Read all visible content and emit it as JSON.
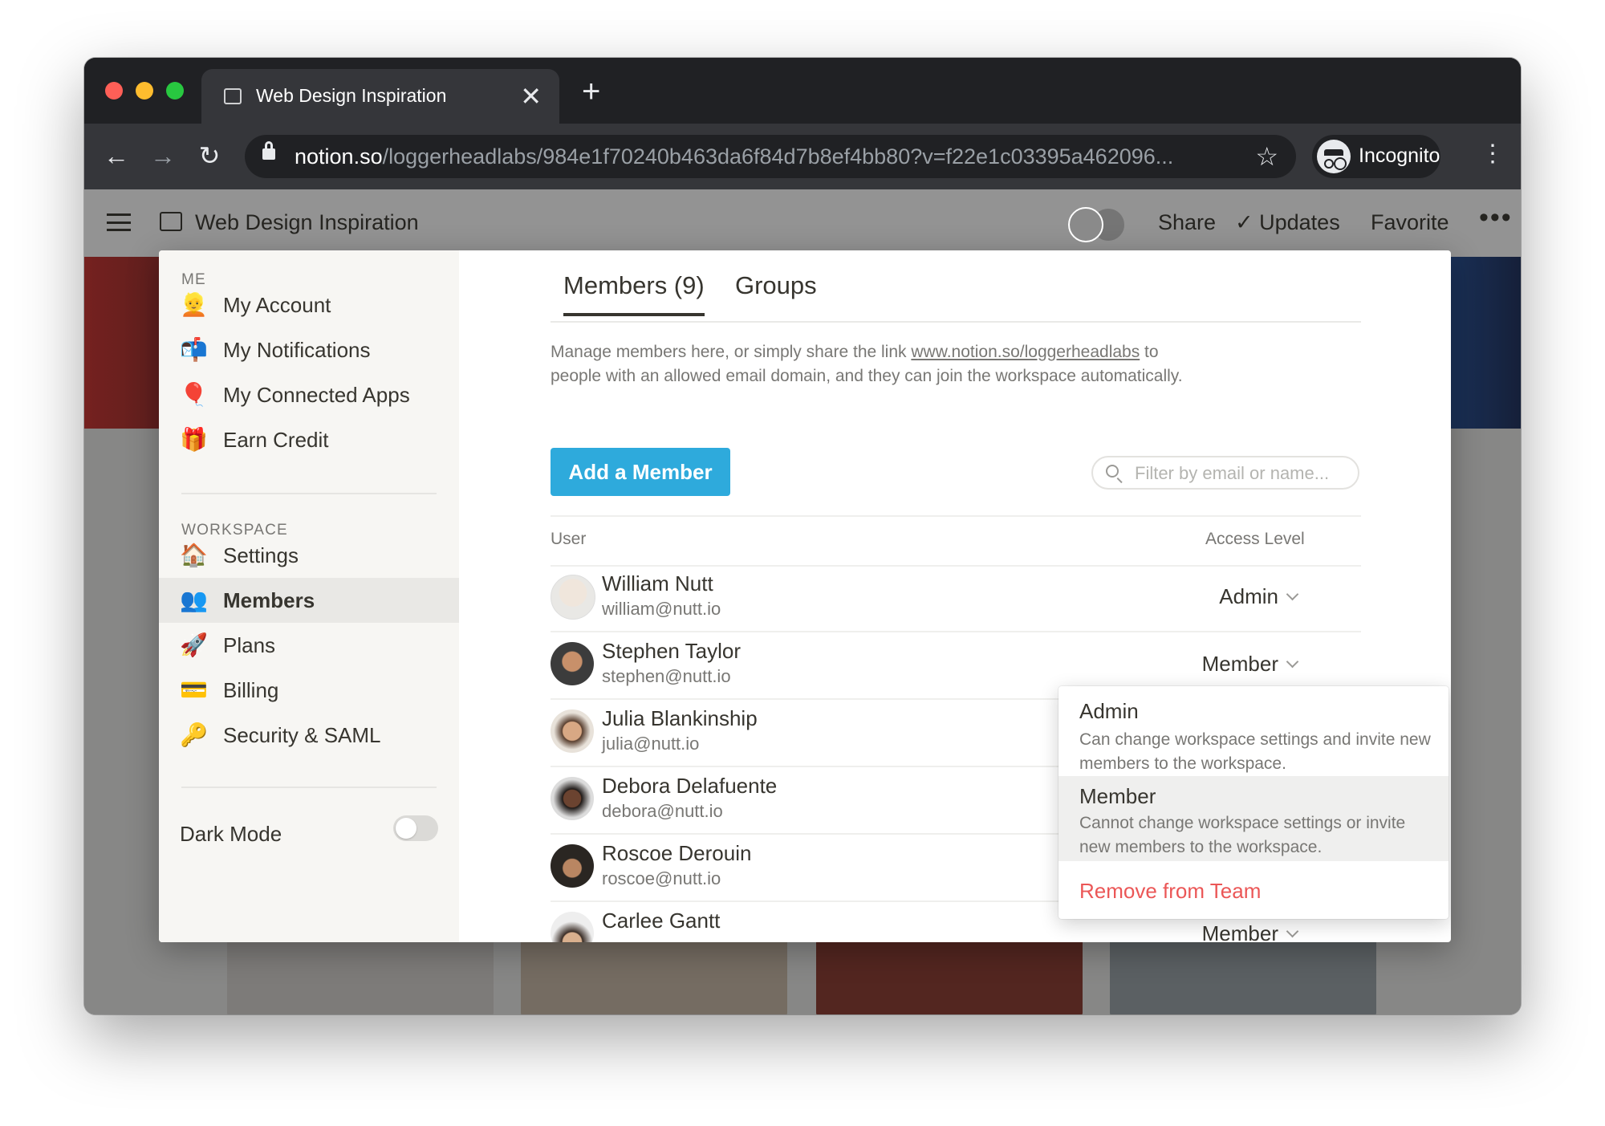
{
  "browser": {
    "tab_title": "Web Design Inspiration",
    "tab_close": "✕",
    "new_tab": "+",
    "url_host": "notion.so",
    "url_path": "/loggerheadlabs/984e1f70240b463da6f84d7b8ef4bb80?v=f22e1c03395a462096...",
    "incognito_label": "Incognito",
    "colors": {
      "chrome_dark": "#202124",
      "chrome_tab": "#35363a",
      "close": "#ff5f57",
      "minimize": "#febc2e",
      "zoom": "#28c840"
    }
  },
  "topbar": {
    "page_title": "Web Design Inspiration",
    "share": "Share",
    "updates": "Updates",
    "favorite": "Favorite",
    "more": "•••"
  },
  "sidebar": {
    "me_heading": "ME",
    "me_items": [
      {
        "label": "My Account",
        "icon": "👱"
      },
      {
        "label": "My Notifications",
        "icon": "📬"
      },
      {
        "label": "My Connected Apps",
        "icon": "🎈"
      },
      {
        "label": "Earn Credit",
        "icon": "🎁"
      }
    ],
    "workspace_heading": "WORKSPACE",
    "workspace_items": [
      {
        "label": "Settings",
        "icon": "🏠"
      },
      {
        "label": "Members",
        "icon": "👥"
      },
      {
        "label": "Plans",
        "icon": "🚀"
      },
      {
        "label": "Billing",
        "icon": "💳"
      },
      {
        "label": "Security & SAML",
        "icon": "🔑"
      }
    ],
    "active_item": "Members",
    "dark_mode_label": "Dark Mode",
    "dark_mode_on": false
  },
  "main": {
    "tabs": [
      "Members (9)",
      "Groups"
    ],
    "active_tab": "Members (9)",
    "desc_before": "Manage members here, or simply share the link ",
    "desc_link": "www.notion.so/loggerheadlabs",
    "desc_after": " to people with an allowed email domain, and they can join the workspace automatically.",
    "add_member": "Add a Member",
    "filter_placeholder": "Filter by email or name...",
    "col_user": "User",
    "col_access": "Access Level",
    "accent": "#2eaadc",
    "members": [
      {
        "name": "William Nutt",
        "email": "william@nutt.io",
        "access": "Admin"
      },
      {
        "name": "Stephen Taylor",
        "email": "stephen@nutt.io",
        "access": "Member"
      },
      {
        "name": "Julia Blankinship",
        "email": "julia@nutt.io",
        "access": ""
      },
      {
        "name": "Debora Delafuente",
        "email": "debora@nutt.io",
        "access": ""
      },
      {
        "name": "Roscoe Derouin",
        "email": "roscoe@nutt.io",
        "access": ""
      },
      {
        "name": "Carlee Gantt",
        "email": "",
        "access": "Member"
      }
    ]
  },
  "dropdown": {
    "options": [
      {
        "name": "Admin",
        "desc": "Can change workspace settings and invite new members to the workspace."
      },
      {
        "name": "Member",
        "desc": "Cannot change workspace settings or invite new members to the workspace."
      }
    ],
    "selected": "Member",
    "remove": "Remove from Team",
    "remove_color": "#eb5757"
  },
  "help": "?"
}
